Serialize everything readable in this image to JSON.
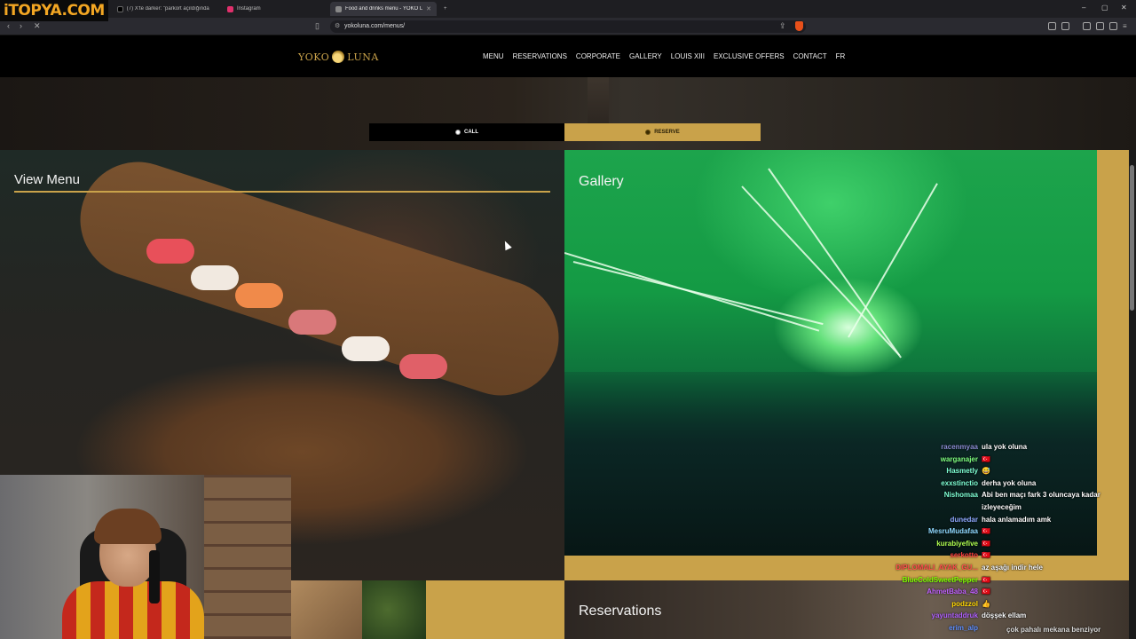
{
  "overlay_logo": "iTOPYA.COM",
  "browser": {
    "tabs": [
      {
        "label": "(7) X'te darker: \"parkort açıldığında",
        "favicon_color": "#000000"
      },
      {
        "label": "Instagram",
        "favicon_color": "#e1306c"
      },
      {
        "label": "Food and drinks menu - YOKO L",
        "favicon_color": "#888888"
      }
    ],
    "new_tab": "+",
    "url": "yokoluna.com/menus/",
    "window_controls": [
      "–",
      "▢",
      "✕"
    ]
  },
  "site": {
    "brand_left": "YOKO",
    "brand_right": "LUNA",
    "nav": [
      "MENU",
      "RESERVATIONS",
      "CORPORATE",
      "GALLERY",
      "LOUIS XIII",
      "EXCLUSIVE OFFERS",
      "CONTACT",
      "FR"
    ],
    "call_label": "CALL",
    "reserve_label": "RESERVE",
    "panels": {
      "menu_title": "View Menu",
      "gallery_title": "Gallery",
      "reservations_title": "Reservations"
    },
    "accent_color": "#c9a24a"
  },
  "chat": {
    "lines": [
      {
        "user": "racenmyaa",
        "msg": "ula yok oluna",
        "color": "#8a8ad0"
      },
      {
        "user": "warganajer",
        "msg": "🇹🇷",
        "color": "#7fff7f"
      },
      {
        "user": "Hasmetly",
        "msg": "😅",
        "color": "#7fffd4"
      },
      {
        "user": "exxstinctio",
        "msg": "derha yok oluna",
        "color": "#7fffd4"
      },
      {
        "user": "Nishomaa",
        "msg": "Abi ben maçı fark 3 oluncaya kadar",
        "color": "#7fffd4"
      },
      {
        "user": "",
        "msg": "izleyeceğim",
        "color": "#ffffff"
      },
      {
        "user": "dunedar",
        "msg": "hala anlamadım amk",
        "color": "#8fa8ff"
      },
      {
        "user": "MesruMudafaa",
        "msg": "🇹🇷",
        "color": "#8fd8ff"
      },
      {
        "user": "kurabiyefive",
        "msg": "🇹🇷",
        "color": "#b0ff50"
      },
      {
        "user": "serkotto",
        "msg": "🇹🇷",
        "color": "#ff4040"
      },
      {
        "user": "DIPLOMALI_AYAK_GU...",
        "msg": "az aşağı indir hele",
        "color": "#ff4d4d"
      },
      {
        "user": "BlueColdSweetPepper",
        "msg": "🇹🇷",
        "color": "#7fff00"
      },
      {
        "user": "AhmetBaba_48",
        "msg": "🇹🇷",
        "color": "#c060ff"
      },
      {
        "user": "podzzol",
        "msg": "👍",
        "color": "#ffd700"
      },
      {
        "user": "yayuntaddruk",
        "msg": "döşşek ellam",
        "color": "#b060ff"
      },
      {
        "user": "erim_alp",
        "msg": "",
        "color": "#5f8fff"
      }
    ],
    "footer": "çok pahalı mekana benziyor"
  }
}
